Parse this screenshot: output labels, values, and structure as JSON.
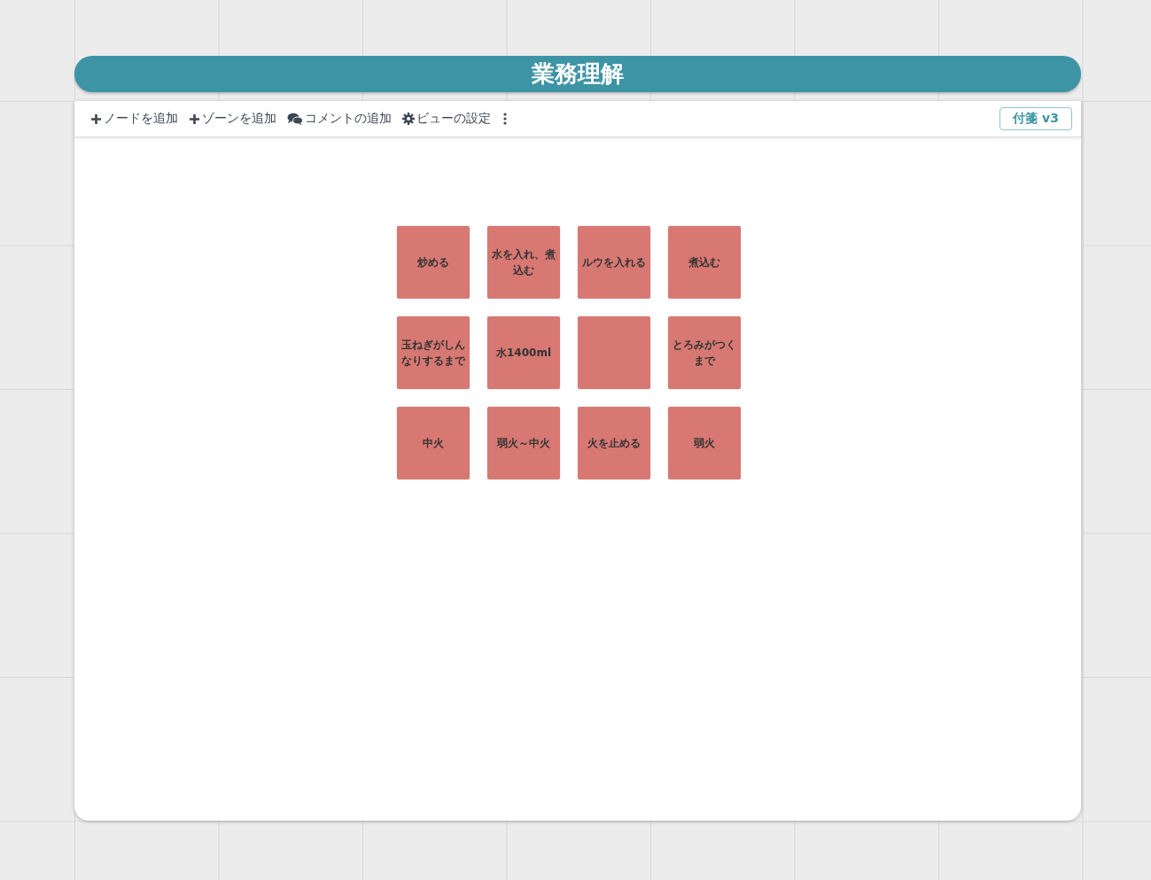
{
  "title": "業務理解",
  "toolbar": [
    {
      "kind": "plus",
      "label": "ノードを追加"
    },
    {
      "kind": "plus",
      "label": "ゾーンを追加"
    },
    {
      "kind": "comment",
      "label": "コメントの追加"
    },
    {
      "kind": "gear",
      "label": "ビューの設定"
    }
  ],
  "version_badge": "付箋 v3",
  "notes": [
    {
      "kind": "text",
      "text": "炒める"
    },
    {
      "kind": "text",
      "text": "水を入れ、煮込む"
    },
    {
      "kind": "text",
      "text": "ルウを入れる"
    },
    {
      "kind": "text",
      "text": "煮込む"
    },
    {
      "kind": "text",
      "text": "玉ねぎがしんなりするまで"
    },
    {
      "kind": "text",
      "text": "水1400ml"
    },
    {
      "kind": "blank"
    },
    {
      "kind": "text",
      "text": "とろみがつくまで"
    },
    {
      "kind": "text",
      "text": "中火"
    },
    {
      "kind": "text",
      "text": "弱火～中火"
    },
    {
      "kind": "text",
      "text": "火を止める"
    },
    {
      "kind": "text",
      "text": "弱火"
    }
  ]
}
